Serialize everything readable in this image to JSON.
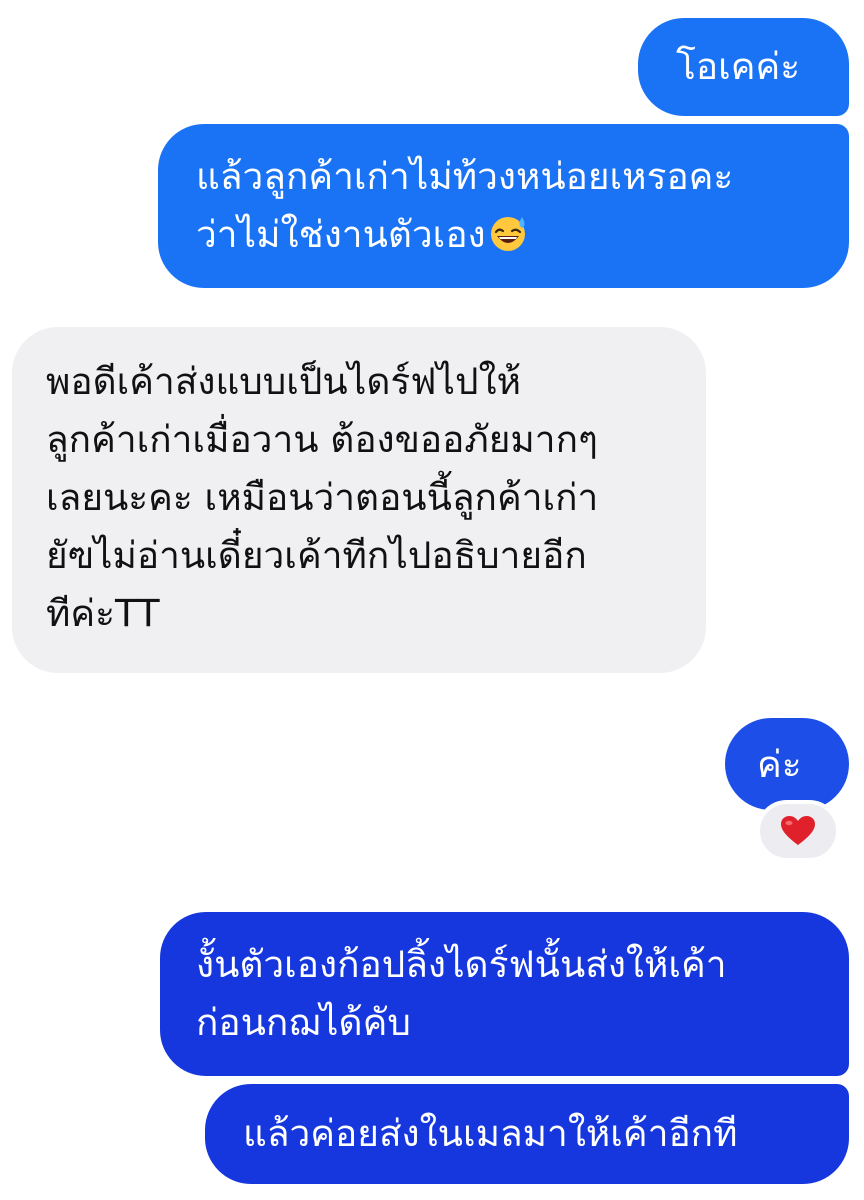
{
  "messages": [
    {
      "direction": "outgoing",
      "lines": [
        "โอเคค่ะ"
      ]
    },
    {
      "direction": "outgoing",
      "lines": [
        "แล้วลูกค้าเก่าไม่ท้วงหน่อยเหรอคะ",
        "ว่าไม่ใช่งานตัวเอง"
      ],
      "trailing_emoji": "grinning-sweat-emoji"
    },
    {
      "direction": "incoming",
      "lines": [
        "พอดีเค้าส่งแบบเป็นไดร์ฟไปให้",
        "ลูกค้าเก่าเมื่อวาน ต้องขออภัยมากๆ",
        "เลยนะคะ เหมือนว่าตอนนี้ลูกค้าเก่า",
        "ยัฃไม่อ่านเดี๋ยวเค้าทีกไปอธิบายอีก",
        "ทีค่ะTT"
      ]
    },
    {
      "direction": "outgoing",
      "lines": [
        "ค่ะ"
      ],
      "reaction": "red-heart-icon"
    },
    {
      "direction": "outgoing",
      "lines": [
        "งั้นตัวเองก้อปลิ้งไดร์ฟนั้นส่งให้เค้า",
        "ก่อนกฌได้คับ"
      ]
    },
    {
      "direction": "outgoing",
      "lines": [
        "แล้วค่อยส่งในเมลมาให้เค้าอีกที"
      ]
    }
  ],
  "colors": {
    "outgoing_top": "#1a73f5",
    "outgoing_mid": "#1d4fe8",
    "outgoing_bottom": "#1637dd",
    "incoming": "#f0f0f3",
    "reaction_heart": "#e0202a"
  }
}
